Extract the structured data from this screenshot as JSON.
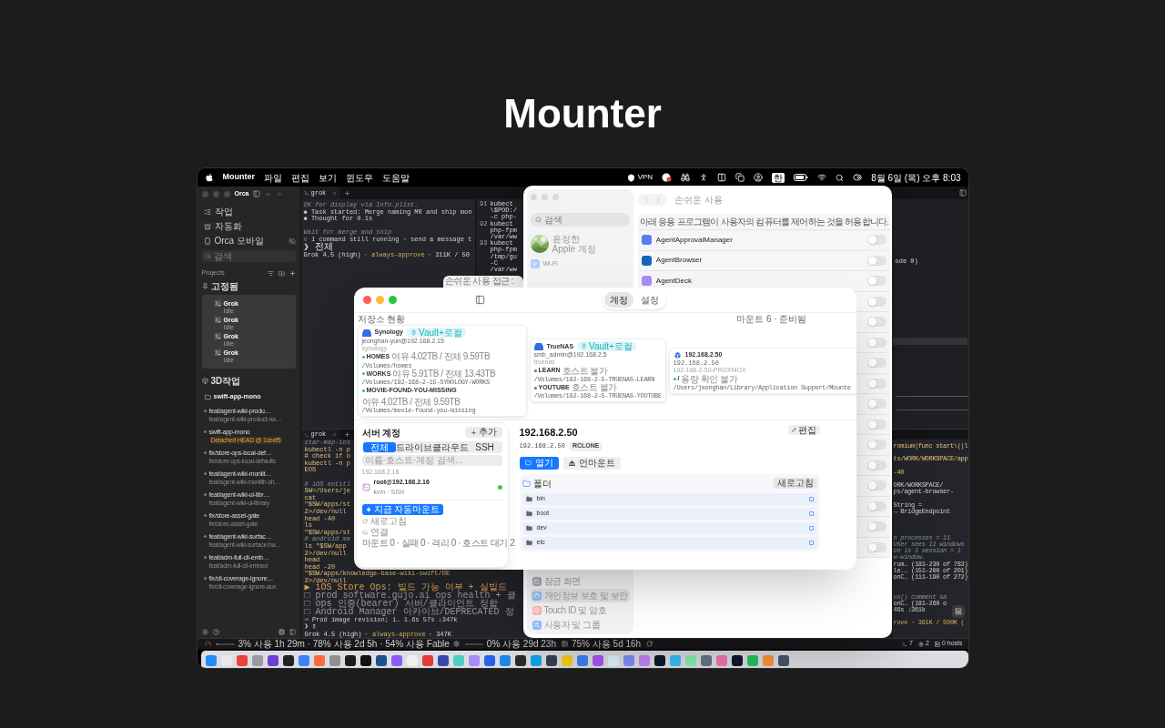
{
  "page_title": "Mounter",
  "menu_bar": {
    "app": "Mounter",
    "menus": [
      "파일",
      "편집",
      "보기",
      "윈도우",
      "도움말"
    ],
    "vpn": "VPN",
    "input_source": "한",
    "clock": "8월 6일 (목) 오후 8:03"
  },
  "orca": {
    "title": "Orca",
    "nav": [
      {
        "kind": "tasks",
        "label": "작업"
      },
      {
        "kind": "automation",
        "label": "자동화"
      },
      {
        "kind": "mobile",
        "label": "Orca 모바일"
      }
    ],
    "search_placeholder": "검색",
    "projects_label": "Projects",
    "pinned_label": "고정됨",
    "pinned": [
      {
        "name": "Grok",
        "status": "Idle"
      },
      {
        "name": "Grok",
        "status": "Idle"
      },
      {
        "name": "Grok",
        "status": "Idle"
      },
      {
        "name": "Grok",
        "status": "Idle"
      }
    ],
    "group_label": "3D작업",
    "repo": "swift-app-mono",
    "branches": [
      {
        "name": "feat/agent-wiki-produ…",
        "sub": "feat/agent-wiki-product-na…"
      },
      {
        "name": "swift-app-mono",
        "badge": "Detached HEAD @ 1ceef5"
      },
      {
        "name": "fix/store-ops-local-def…",
        "sub": "fix/store-ops-local-defaults"
      },
      {
        "name": "feat/agent-wiki-monlit…",
        "sub": "feat/agent-wiki-monlith-sh…"
      },
      {
        "name": "feat/agent-wiki-ui-libr…",
        "sub": "feat/agent-wiki-ui-library"
      },
      {
        "name": "fix/store-asset-gate",
        "sub": "fix/store-asset-gate"
      },
      {
        "name": "feat/agent-wiki-surfac…",
        "sub": "feat/agent-wiki-surface-ha…"
      },
      {
        "name": "feat/adm-full-cli-emb…",
        "sub": "feat/adm-full-cli-embed"
      },
      {
        "name": "fix/cli-coverage-ignore…",
        "sub": "fix/cli-coverage-ignore-aux"
      }
    ]
  },
  "top_terminal": {
    "tab": "grok",
    "lines": [
      {
        "kind": "comment",
        "text": "OK for display via Info.plist."
      },
      {
        "kind": "text",
        "text": "◆ Task started: Merge naming MR and ship mon"
      },
      {
        "kind": "text",
        "text": "◆ Thought for 0.1s"
      },
      {
        "kind": "blank"
      },
      {
        "kind": "comment",
        "text": "Wait for merge and ship"
      },
      {
        "kind": "text",
        "text": "○ 1 command still running · send a message t"
      },
      {
        "kind": "prompt",
        "text": "❯ 전체"
      },
      {
        "kind": "status",
        "model": "Grok 4.5 (high)",
        "mode": "· always-approve",
        "usage": "· 311K / 50"
      }
    ]
  },
  "code_pane": {
    "blocks": [
      {
        "number": "91",
        "lines": [
          "kubect",
          "\\$POD:/",
          "-c php-"
        ]
      },
      {
        "number": "92",
        "lines": [
          "kubect",
          "php-fpm",
          "/var/ww"
        ]
      },
      {
        "number": "93",
        "lines": [
          "kubect",
          "php-fpm",
          "/tmp/gu",
          "-C",
          "/var/ww"
        ]
      }
    ],
    "right_fragment": "ode 0)"
  },
  "bottom_terminal": {
    "tab": "grok",
    "lines": [
      {
        "kind": "comment",
        "text": "star-map-ios"
      },
      {
        "kind": "cmd",
        "text": "kubectl -n p"
      },
      {
        "kind": "cmd",
        "text": "# check if o"
      },
      {
        "kind": "cmd",
        "text": "kubectl -n p"
      },
      {
        "kind": "cmd",
        "text": "EOS"
      },
      {
        "kind": "blank"
      },
      {
        "kind": "comment",
        "text": "# iOS entitl"
      },
      {
        "kind": "cmd",
        "text": "SW=/Users/je"
      },
      {
        "kind": "cmd",
        "text": "cat"
      },
      {
        "kind": "cmd",
        "text": "\"$SW/apps/st"
      },
      {
        "kind": "cmd",
        "text": "2>/dev/null"
      },
      {
        "kind": "cmd",
        "text": "head -40"
      },
      {
        "kind": "cmd",
        "text": "ls"
      },
      {
        "kind": "cmd",
        "text": "\"$SW/apps/st"
      },
      {
        "kind": "comment",
        "text": "# android ma"
      },
      {
        "kind": "cmd",
        "text": "ls \"$SW/app"
      },
      {
        "kind": "cmd",
        "text": "2>/dev/null"
      },
      {
        "kind": "cmd",
        "text": "head"
      },
      {
        "kind": "cmd",
        "text": "head -20"
      },
      {
        "kind": "cmd",
        "text": "\"$SW/apps/knowledge-base-wiki-swift/DE"
      },
      {
        "kind": "cmd",
        "text": "2>/dev/null"
      },
      {
        "kind": "task",
        "text": "▶ iOS Store Ops: 빌드 가능 여부 + 실빌드"
      },
      {
        "kind": "todo",
        "text": "□ prod software.gujo.ai ops health + 클"
      },
      {
        "kind": "todo",
        "text": "□ ops 인증(bearer) 서버/클라이언트 정합"
      },
      {
        "kind": "todo",
        "text": "□ Android Manager 아카이브/DEPRECATED 정"
      },
      {
        "kind": "text",
        "text": "⏎ Prod image revision; i… 1.6s 57s ↓347k"
      },
      {
        "kind": "input",
        "text": "❯ ▯"
      },
      {
        "kind": "status",
        "model": "Grok 4.5 (high)",
        "mode": "· always-approve",
        "usage": "· 347K"
      }
    ],
    "right_lines": [
      {
        "kind": "cmd",
        "text": "romium|func start\\(|l"
      },
      {
        "kind": "blank"
      },
      {
        "kind": "cmd",
        "text": "ts/WORK/WORKSPACE/app"
      },
      {
        "kind": "blank"
      },
      {
        "kind": "cmd",
        "text": "-40"
      },
      {
        "kind": "blank"
      },
      {
        "kind": "text",
        "text": "ORK/WORKSPACE/"
      },
      {
        "kind": "text",
        "text": "ps/agent-browser-"
      },
      {
        "kind": "blank"
      },
      {
        "kind": "text",
        "text": "String ="
      },
      {
        "kind": "text",
        "text": "→ BridgeEndpoint"
      },
      {
        "kind": "blank"
      },
      {
        "kind": "blank"
      },
      {
        "kind": "blank"
      },
      {
        "kind": "comment",
        "text": "n processes = 11"
      },
      {
        "kind": "comment",
        "text": "User sees 11 windows"
      },
      {
        "kind": "comment",
        "text": "on is 1 session = 1"
      },
      {
        "kind": "comment",
        "text": "w-window."
      },
      {
        "kind": "text",
        "text": "rom… (181-230 of 783)"
      },
      {
        "kind": "text",
        "text": "le.… (151-200 of 201)"
      },
      {
        "kind": "text",
        "text": "onC… (111-190 of 272)"
      },
      {
        "kind": "blank"
      },
      {
        "kind": "blank"
      },
      {
        "kind": "comment",
        "text": "us() comment sa"
      },
      {
        "kind": "text",
        "text": "onC… (181-260 o"
      },
      {
        "kind": "text",
        "text": "46s ↓361k"
      },
      {
        "kind": "blank"
      },
      {
        "kind": "status",
        "text": "rove · 361K / 500K ("
      }
    ]
  },
  "status_bar": {
    "usage": [
      {
        "kind": "meter",
        "level": 0.03,
        "text": "3% 사용 1h 29m · 78% 사용 2d 5h · 54% 사용 Fable"
      },
      {
        "kind": "meter",
        "level": 0.0,
        "text": "0% 사용 29d 23h"
      },
      {
        "kind": "plain",
        "text": "75% 사용 5d 16h"
      }
    ],
    "terminals": "7",
    "processes": "2",
    "hosts": "0 hosts"
  },
  "behind_window": {
    "text": "손쉬운 사용 접근 :"
  },
  "settings": {
    "search_placeholder": "검색",
    "account_name": "윤정한",
    "account_sub": "Apple 계정",
    "wifi": "Wi-Fi",
    "sidebar_items": [
      {
        "kind": "lock",
        "label": "잠금 화면",
        "selected": false
      },
      {
        "kind": "privacy",
        "label": "개인정보 보호 및 보안",
        "selected": true
      },
      {
        "kind": "touchid",
        "label": "Touch ID 및 암호",
        "selected": false
      },
      {
        "kind": "users",
        "label": "사용자 및 그룹",
        "selected": false
      }
    ],
    "title": "손쉬운 사용",
    "description": "아래 응용 프로그램이 사용자의 컴퓨터를 제어하는 것을 허용합니다.",
    "apps": [
      {
        "name": "AgentApprovalManager",
        "on": false
      },
      {
        "name": "AgentBrowser",
        "on": false
      },
      {
        "name": "AgentDeck",
        "on": false
      }
    ],
    "hidden_rows": [
      {
        "on": false
      },
      {
        "on": false
      },
      {
        "on": false
      },
      {
        "on": false
      },
      {
        "on": false
      },
      {
        "on": false
      },
      {
        "on": false
      },
      {
        "on": false
      },
      {
        "on": false
      },
      {
        "on": false
      },
      {
        "on": false
      },
      {
        "on": false
      },
      {
        "on": false
      }
    ]
  },
  "mounter": {
    "segments": [
      {
        "label": "계정",
        "selected": true
      },
      {
        "label": "설정",
        "selected": false
      }
    ],
    "overview_label": "저장소 현황",
    "overview_status": "마운트 6 · 준비됨",
    "storages": [
      {
        "kind": "nas",
        "name": "Synology",
        "badge": "Vault+로컬",
        "account": "jeonghan-yun@192.168.2.15",
        "slug": "synology",
        "mounts": [
          {
            "name": "HOMES",
            "info": "여유 4.02TB / 전체 9.59TB",
            "path": "/Volumes/homes",
            "color": "#34c759"
          },
          {
            "name": "WORKS",
            "info": "여유 5.91TB / 전체 13.43TB",
            "path": "/Volumes/192-168-2-15-SYNOLOGY-WORKS",
            "color": "#34c759"
          },
          {
            "name": "MOVIE-FOUND-YOU-MISSING",
            "info": "여유 4.02TB / 전체 9.59TB",
            "path": "/Volumes/movie-found-you-missing",
            "color": "#34c759"
          }
        ]
      },
      {
        "kind": "nas",
        "name": "TrueNAS",
        "badge": "Vault+로컬",
        "account": "smb_admin@192.168.2.5",
        "slug": "truenas",
        "mounts": [
          {
            "name": "LEARN",
            "info": "호스트 불가",
            "path": "/Volumes/192-168-2-5-TRUENAS-LEARN",
            "color": "#6e6e73"
          },
          {
            "name": "YOUTUBE",
            "info": "호스트 불가",
            "path": "/Volumes/192-168-2-5-TRUENAS-YOUTUBE",
            "color": "#6e6e73"
          }
        ]
      },
      {
        "kind": "host",
        "name": "192.168.2.50",
        "account": "192.168.2.50",
        "slug": "192-168-2-50-PROXMOX",
        "mounts": [
          {
            "name": "/",
            "info": "용량 확인 불가",
            "path": "/Users/jeonghan/Library/Application Support/Mounte",
            "color": "#34c759"
          }
        ]
      }
    ],
    "accounts": {
      "title": "서버 계정",
      "add": "추가",
      "tabs": [
        {
          "label": "전체",
          "selected": true
        },
        {
          "label": "드라이브",
          "selected": false
        },
        {
          "label": "클라우드",
          "selected": false
        },
        {
          "label": "SSH",
          "selected": false
        }
      ],
      "search_placeholder": "이름·호스트·계정 검색...",
      "group": "192.168.2.16",
      "items": [
        {
          "name": "root@192.168.2.16",
          "sub": "kvm · SSH",
          "color": "#34c759"
        }
      ],
      "automount": "지금 자동마운트",
      "refresh": "새로고침",
      "connect": "연결",
      "footer": "마운트 0 · 실패 0 · 격리 0 · 호스트 대기 2"
    },
    "detail": {
      "title": "192.168.2.50",
      "address": "192.168.2.50",
      "badge": "RCLONE",
      "edit": "편집",
      "open": "열기",
      "unmount": "언마운트",
      "folder_title": "폴더",
      "refresh": "새로고침",
      "folders": [
        "bin",
        "boot",
        "dev",
        "etc"
      ]
    }
  }
}
